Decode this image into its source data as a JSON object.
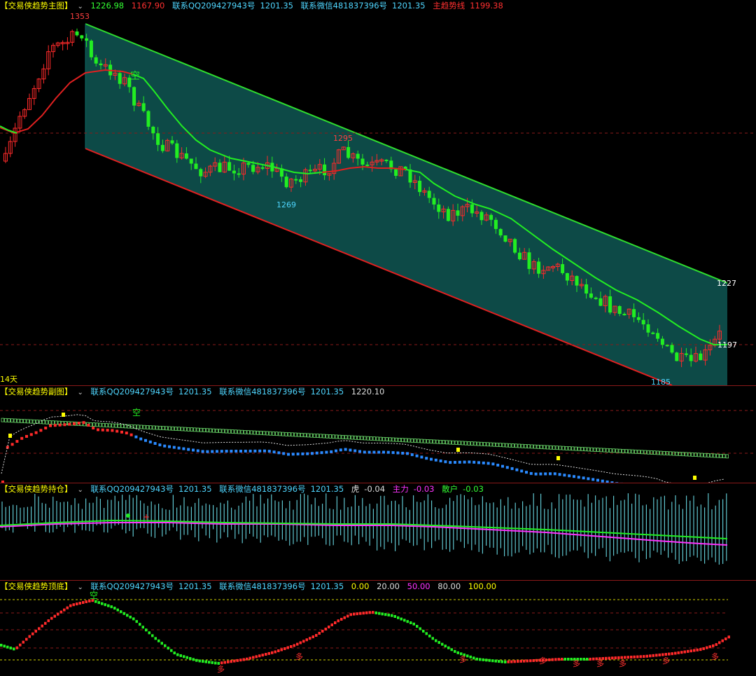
{
  "main": {
    "title": "【交易侠趋势主图】",
    "v1": "1226.98",
    "v2": "1167.90",
    "qq": "联系QQ209427943号",
    "qq_val": "1201.35",
    "wx": "联系微信481837396号",
    "wx_val": "1201.35",
    "trend_label": "主趋势线",
    "trend_val": "1199.38",
    "period_label": "14天",
    "marker_kong": "空",
    "price_labels": [
      "1353",
      "1295",
      "1269",
      "1227",
      "1197",
      "1185"
    ]
  },
  "sub": {
    "title": "【交易侠趋势副图】",
    "qq": "联系QQ209427943号",
    "qq_val": "1201.35",
    "wx": "联系微信481837396号",
    "wx_val": "1201.35",
    "extra_val": "1220.10",
    "marker_kong": "空"
  },
  "hold": {
    "title": "【交易侠趋势持仓】",
    "qq": "联系QQ209427943号",
    "qq_val": "1201.35",
    "wx": "联系微信481837396号",
    "wx_val": "1201.35",
    "hu_label": "虎",
    "hu_val": "-0.04",
    "zl_label": "主力",
    "zl_val": "-0.03",
    "sh_label": "散户",
    "sh_val": "-0.03"
  },
  "tb": {
    "title": "【交易侠趋势顶底】",
    "qq": "联系QQ209427943号",
    "qq_val": "1201.35",
    "wx": "联系微信481837396号",
    "wx_val": "1201.35",
    "levels": [
      "0.00",
      "20.00",
      "50.00",
      "80.00",
      "100.00"
    ],
    "marker_kong": "空",
    "marker_duo": "多"
  },
  "colors": {
    "up": "#ff2a2a",
    "down": "#22ee22",
    "channel_fill": "#0d4a47",
    "channel_top": "#2fdc2f",
    "channel_bottom": "#e02020",
    "accent_cyan": "#4fd6ff"
  },
  "chart_data": {
    "type": "line",
    "title": "交易侠趋势主图",
    "series": [
      {
        "name": "主趋势线",
        "last": 1199.38
      }
    ],
    "channel": {
      "upper_end": 1227,
      "lower_start_high": 1353,
      "current": 1197,
      "low": 1185
    },
    "annotations": [
      {
        "label": "1353"
      },
      {
        "label": "1295"
      },
      {
        "label": "1269"
      },
      {
        "label": "1227"
      },
      {
        "label": "1197"
      },
      {
        "label": "1185"
      }
    ],
    "trend": "downtrend channel"
  }
}
